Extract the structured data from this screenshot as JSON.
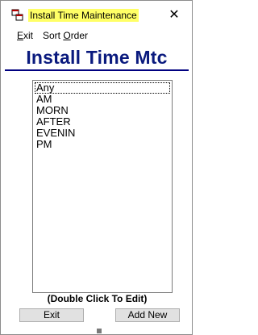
{
  "window": {
    "title": "Install Time Maintenance",
    "title_highlight": "#ffff66",
    "close_glyph": "✕"
  },
  "menu": {
    "exit_accel": "E",
    "exit_rest": "xit",
    "sort_first": "Sort ",
    "sort_accel": "O",
    "sort_rest": "rder"
  },
  "heading": {
    "text": "Install Time Mtc",
    "color": "#0a1a7e"
  },
  "list": {
    "items": [
      "Any",
      "AM",
      "MORN",
      "AFTER",
      "EVENIN",
      "PM"
    ],
    "focused_index": 0
  },
  "hint": "(Double Click To Edit)",
  "buttons": {
    "exit_label": "Exit",
    "add_label": "Add New"
  },
  "icons": {
    "app": "app-windows-icon",
    "close": "close-icon"
  }
}
